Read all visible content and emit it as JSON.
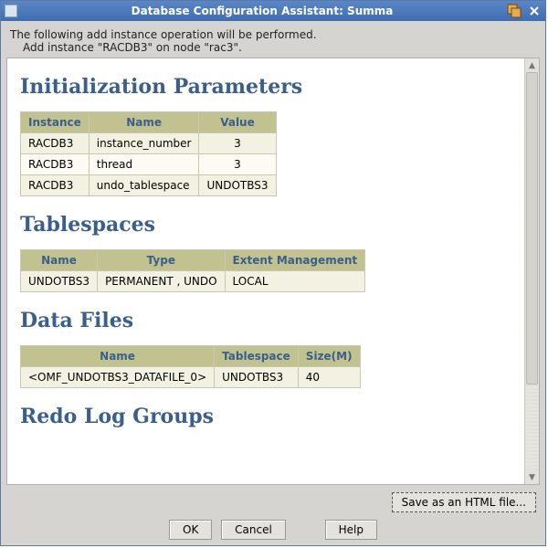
{
  "window": {
    "title": "Database Configuration Assistant: Summa"
  },
  "intro": {
    "line1": "The following add instance operation will be performed.",
    "line2": "Add instance \"RACDB3\" on node \"rac3\"."
  },
  "sections": {
    "init_params": {
      "title": "Initialization Parameters",
      "headers": [
        "Instance",
        "Name",
        "Value"
      ],
      "rows": [
        [
          "RACDB3",
          "instance_number",
          "3"
        ],
        [
          "RACDB3",
          "thread",
          "3"
        ],
        [
          "RACDB3",
          "undo_tablespace",
          "UNDOTBS3"
        ]
      ]
    },
    "tablespaces": {
      "title": "Tablespaces",
      "headers": [
        "Name",
        "Type",
        "Extent Management"
      ],
      "rows": [
        [
          "UNDOTBS3",
          "PERMANENT , UNDO",
          "LOCAL"
        ]
      ]
    },
    "data_files": {
      "title": "Data Files",
      "headers": [
        "Name",
        "Tablespace",
        "Size(M)"
      ],
      "rows": [
        [
          "<OMF_UNDOTBS3_DATAFILE_0>",
          "UNDOTBS3",
          "40"
        ]
      ]
    },
    "redo_log": {
      "title": "Redo Log Groups"
    }
  },
  "buttons": {
    "save_html": "Save as an HTML file...",
    "ok": "OK",
    "cancel": "Cancel",
    "help": "Help"
  }
}
